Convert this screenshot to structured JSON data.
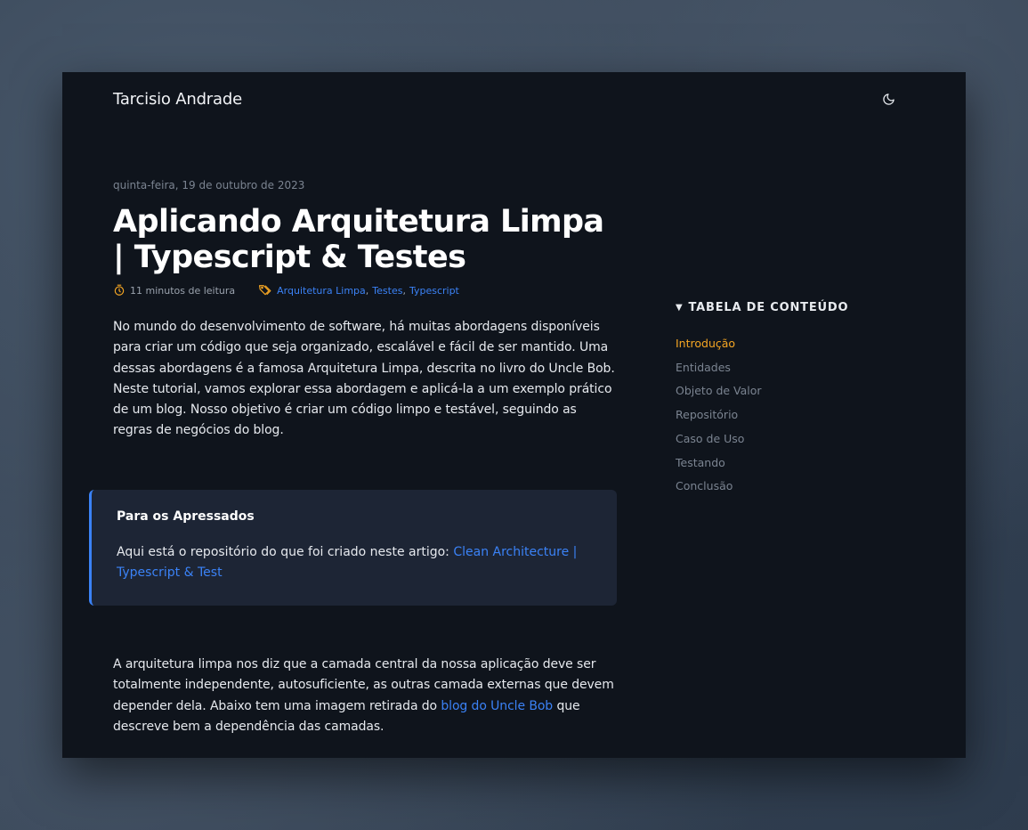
{
  "header": {
    "site_title": "Tarcisio Andrade",
    "theme_icon": "moon-icon"
  },
  "post": {
    "date": "quinta-feira, 19 de outubro de 2023",
    "title": "Aplicando Arquitetura Limpa | Typescript & Testes",
    "reading_time": "11 minutos de leitura",
    "tags": [
      "Arquitetura Limpa",
      "Testes",
      "Typescript"
    ],
    "intro": "No mundo do desenvolvimento de software, há muitas abordagens disponíveis para criar um código que seja organizado, escalável e fácil de ser mantido. Uma dessas abordagens é a famosa Arquitetura Limpa, descrita no livro do Uncle Bob. Neste tutorial, vamos explorar essa abordagem e aplicá-la a um exemplo prático de um blog. Nosso objetivo é criar um código limpo e testável, seguindo as regras de negócios do blog.",
    "callout": {
      "title": "Para os Apressados",
      "text": "Aqui está o repositório do que foi criado neste artigo: ",
      "link_text": "Clean Architecture | Typescript & Test"
    },
    "second_para": {
      "before": "A arquitetura limpa nos diz que a camada central da nossa aplicação deve ser totalmente independente, autosuficiente, as outras camada externas que devem depender dela. Abaixo tem uma imagem retirada do ",
      "link_text": "blog do Uncle Bob",
      "after": " que descreve bem a dependência das camadas."
    }
  },
  "toc": {
    "heading": "TABELA DE CONTEÚDO",
    "items": [
      "Introdução",
      "Entidades",
      "Objeto de Valor",
      "Repositório",
      "Caso de Uso",
      "Testando",
      "Conclusão"
    ],
    "active_index": 0
  },
  "colors": {
    "accent_link": "#3b82f6",
    "toc_active": "#f5a623",
    "meta_icon": "#f5a623",
    "window_bg": "#0f141c",
    "callout_bg": "#1d2535"
  }
}
